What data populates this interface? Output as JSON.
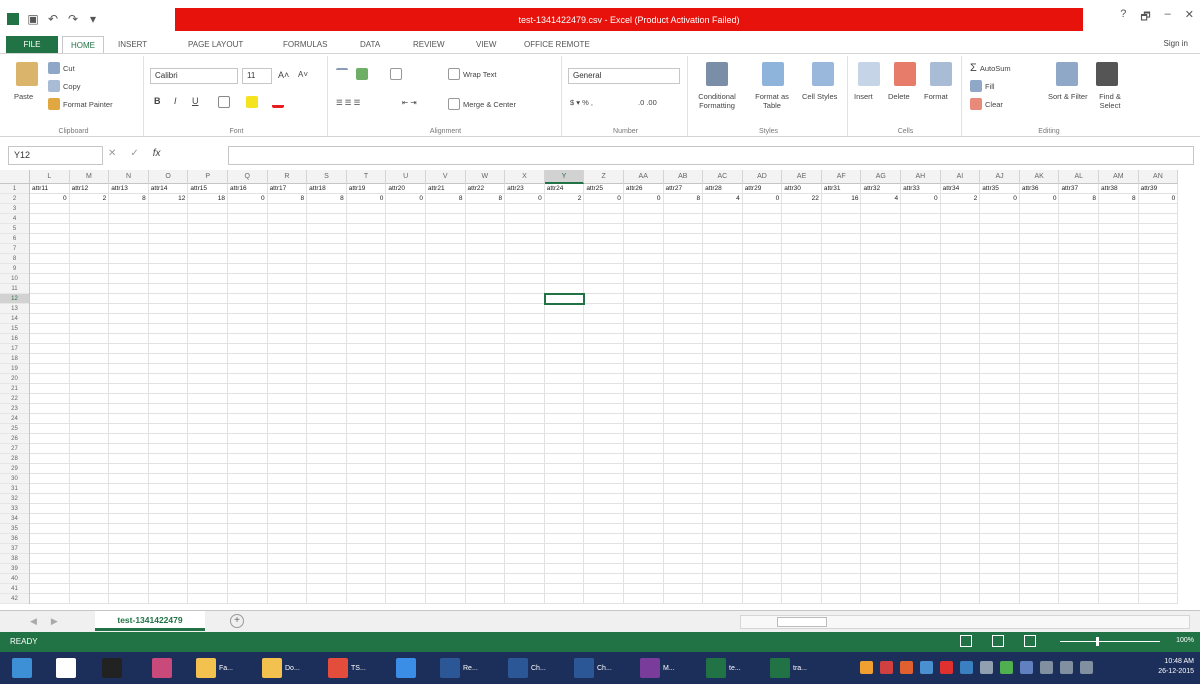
{
  "window": {
    "title": "test-1341422479.csv - Excel (Product Activation Failed)",
    "help": "?",
    "minimize": "–",
    "restore": "🗗",
    "close": "✕"
  },
  "qat": [
    "excel-logo-icon",
    "save-icon",
    "undo-icon",
    "redo-icon",
    "customize-icon"
  ],
  "tabs": {
    "file": "FILE",
    "items": [
      {
        "label": "HOME",
        "active": true
      },
      {
        "label": "INSERT",
        "active": false
      },
      {
        "label": "PAGE LAYOUT",
        "active": false
      },
      {
        "label": "FORMULAS",
        "active": false
      },
      {
        "label": "DATA",
        "active": false
      },
      {
        "label": "REVIEW",
        "active": false
      },
      {
        "label": "VIEW",
        "active": false
      },
      {
        "label": "OFFICE REMOTE",
        "active": false
      }
    ],
    "signin": "Sign in"
  },
  "ribbon": {
    "clipboard": {
      "label": "Clipboard",
      "paste": "Paste",
      "cut": "Cut",
      "copy": "Copy",
      "format_painter": "Format Painter"
    },
    "font": {
      "label": "Font",
      "font_name": "Calibri",
      "font_size": "11",
      "bold": "B",
      "italic": "I",
      "underline": "U"
    },
    "alignment": {
      "label": "Alignment",
      "wrap": "Wrap Text",
      "merge": "Merge & Center"
    },
    "number": {
      "label": "Number",
      "format": "General"
    },
    "styles": {
      "label": "Styles",
      "conditional": "Conditional Formatting",
      "format_table": "Format as Table",
      "cell_styles": "Cell Styles"
    },
    "cells": {
      "label": "Cells",
      "insert": "Insert",
      "delete": "Delete",
      "format": "Format"
    },
    "editing": {
      "label": "Editing",
      "autosum": "AutoSum",
      "fill": "Fill",
      "clear": "Clear",
      "sort": "Sort & Filter",
      "find": "Find & Select"
    }
  },
  "formula_bar": {
    "name_box": "Y12",
    "fx": "fx",
    "value": ""
  },
  "columns": [
    "L",
    "M",
    "N",
    "O",
    "P",
    "Q",
    "R",
    "S",
    "T",
    "U",
    "V",
    "W",
    "X",
    "Y",
    "Z",
    "AA",
    "AB",
    "AC",
    "AD",
    "AE",
    "AF",
    "AG",
    "AH",
    "AI",
    "AJ",
    "AK",
    "AL",
    "AM",
    "AN"
  ],
  "selected_column": "Y",
  "row_numbers": [
    "1",
    "2",
    "3",
    "4",
    "5",
    "6",
    "7",
    "8",
    "9",
    "10",
    "11",
    "12",
    "13",
    "14",
    "15",
    "16",
    "17",
    "18",
    "19",
    "20",
    "21",
    "22",
    "23",
    "24",
    "25",
    "26",
    "27",
    "28",
    "29",
    "30",
    "31",
    "32",
    "33",
    "34",
    "35",
    "36",
    "37",
    "38",
    "39",
    "40",
    "41",
    "42"
  ],
  "selected_row": "12",
  "header_row": [
    "attr11",
    "attr12",
    "attr13",
    "attr14",
    "attr15",
    "attr16",
    "attr17",
    "attr18",
    "attr19",
    "attr20",
    "attr21",
    "attr22",
    "attr23",
    "attr24",
    "attr25",
    "attr26",
    "attr27",
    "attr28",
    "attr29",
    "attr30",
    "attr31",
    "attr32",
    "attr33",
    "attr34",
    "attr35",
    "attr36",
    "attr37",
    "attr38",
    "attr39"
  ],
  "data_row": [
    "0",
    "2",
    "8",
    "12",
    "18",
    "0",
    "8",
    "8",
    "0",
    "0",
    "8",
    "8",
    "0",
    "2",
    "0",
    "0",
    "8",
    "4",
    "0",
    "22",
    "16",
    "4",
    "0",
    "2",
    "0",
    "0",
    "8",
    "8",
    "0"
  ],
  "sheet": {
    "tab": "test-1341422479",
    "add": "+"
  },
  "status": {
    "ready": "READY",
    "zoom": "100%"
  },
  "taskbar": {
    "items": [
      {
        "icon": "windows-start-icon",
        "label": ""
      },
      {
        "icon": "home-icon",
        "label": ""
      },
      {
        "icon": "camera-icon",
        "label": ""
      },
      {
        "icon": "app-icon",
        "label": ""
      },
      {
        "icon": "folder-icon",
        "label": "Fa..."
      },
      {
        "icon": "folder-icon",
        "label": "Do..."
      },
      {
        "icon": "chrome-icon",
        "label": "TS..."
      },
      {
        "icon": "ie-icon",
        "label": ""
      },
      {
        "icon": "word-icon",
        "label": "Re..."
      },
      {
        "icon": "word-icon",
        "label": "Ch..."
      },
      {
        "icon": "word-icon",
        "label": "Ch..."
      },
      {
        "icon": "media-icon",
        "label": "M..."
      },
      {
        "icon": "excel-icon",
        "label": "te..."
      },
      {
        "icon": "excel-icon",
        "label": "tra..."
      }
    ],
    "time": "10:48 AM",
    "date": "26-12-2015"
  },
  "colors": {
    "excel_green": "#217346",
    "title_red": "#e8120c",
    "taskbar": "#1c2f5a"
  }
}
